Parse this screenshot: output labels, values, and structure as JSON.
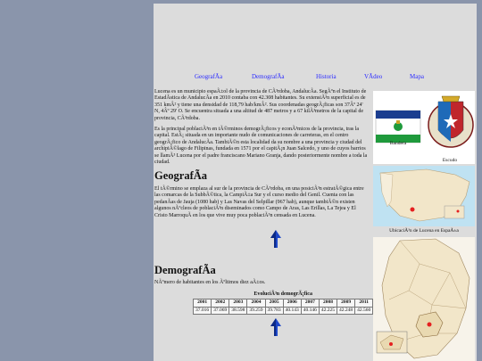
{
  "nav": {
    "items": [
      "GeografÃa",
      "DemografÃa",
      "Historia",
      "VÃdeo",
      "Mapa"
    ]
  },
  "intro": {
    "p1": "Lucena es un municipio espaÃ±ol de la provincia de CÃ³rdoba, AndalucÃa. SegÃºn el Instituto de EstadÃstica de AndalucÃa en 2010 contaba con 42.308 habitantes. Su extensiÃ³n superficial es de 351 kmÂ² y tiene una densidad de 118,79 hab/kmÂ². Sus coordenadas geogrÃ¡ficas son 37Âº 24' N, 4Âº 29' O. Se encuentra situada a una altitud de 487 metros y a 67 kilÃ³metros de la capital de provincia, CÃ³rdoba.",
    "p2": "Es la principal poblaciÃ³n en tÃ©rminos demogrÃ¡ficos y econÃ³micos de la provincia, tras la capital. EstÃ¡ situada en un importante nudo de comunicaciones de carreteras, en el centro geogrÃ¡fico de AndalucÃa. TambiÃ©n esta localidad da su nombre a una provincia y ciudad del archipiÃ©lago de Filipinas, fundada en 1571 por el capitÃ¡n Juan Salcedo, y uno de cuyos barrios se llamÃ³ Lucena por el padre franciscano Mariano Granja, dando posteriormente nombre a toda la ciudad."
  },
  "geografia": {
    "heading": "GeografÃa",
    "text": "El tÃ©rmino se emplaza al sur de la provincia de CÃ³rdoba, en una posiciÃ³n estratÃ©gica entre las comarcas de la SubbÃ©tica, la CampiÃ±a Sur y el curso medio del Genil. Cuenta con las pedanÃas de Jauja (1080 hab) y Las Navas del Selpillar (967 hab), aunque tambiÃ©n existen algunos nÃºcleos de poblaciÃ³n diseminados como Campo de Aras, Las Erillas, La Tejea y El Cristo MarroquÃ en los que vive muy poca poblaciÃ³n censada en Lucena."
  },
  "demografia": {
    "heading": "DemografÃa",
    "text": "NÃºmero de habitantes en los Ãºltimos diez aÃ±os.",
    "table_caption": "EvoluciÃ³n demogrÃ¡fica",
    "years": [
      "2001",
      "2002",
      "2003",
      "2004",
      "2005",
      "2006",
      "2007",
      "2008",
      "2009",
      "2011"
    ],
    "values": [
      "37.016",
      "37.069",
      "38.598",
      "39.259",
      "39.783",
      "40.143",
      "40.146",
      "42.225",
      "42.248",
      "42.560"
    ]
  },
  "sidebar": {
    "flag_caption": "Bandera",
    "shield_caption": "Escudo",
    "map1_caption": "UbicaciÃ³n de Lucena en EspaÃ±a",
    "colors": {
      "flag_green": "#1f9a3c",
      "flag_white": "#ffffff",
      "flag_blue": "#1a3d8f",
      "map_land": "#f2e6c9",
      "map_sea": "#bfe2f2",
      "map_highlight": "#e52020"
    },
    "icons": [
      "up-arrow-icon"
    ]
  }
}
